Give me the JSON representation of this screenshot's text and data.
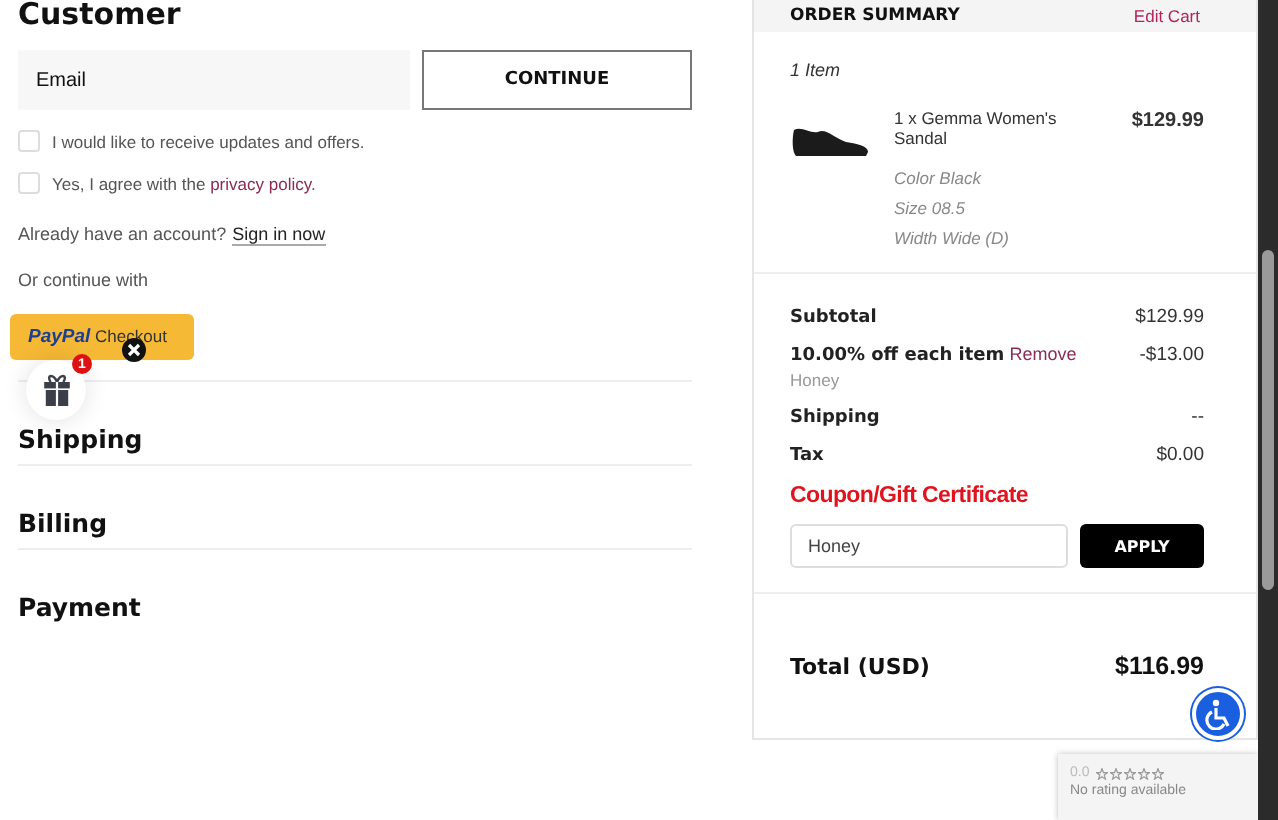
{
  "customer": {
    "heading": "Customer",
    "email": {
      "placeholder": "Email"
    },
    "continue_button": "CONTINUE",
    "checkboxes": [
      {
        "text": "I would like to receive updates and offers.",
        "checked": false
      },
      {
        "text": "Yes, I agree with the ",
        "link": "privacy policy",
        "after": ".",
        "checked": false
      }
    ],
    "account_prompt": "Already have an account?",
    "sign_in_link": "Sign in now",
    "continue_with": "Or continue with",
    "paypal": {
      "brand": "PayPal",
      "label": "Checkout"
    }
  },
  "gift_badge": "1",
  "sections": [
    "Shipping",
    "Billing",
    "Payment"
  ],
  "order_summary": {
    "heading": "ORDER SUMMARY",
    "edit_link": "Edit Cart",
    "item_count": "1 Item",
    "items": [
      {
        "name": "1 x Gemma Women's Sandal",
        "price": "$129.99",
        "details": [
          "Color Black",
          "Size 08.5",
          "Width Wide (D)"
        ]
      }
    ],
    "lines": [
      {
        "label": "Subtotal",
        "value": "$129.99"
      },
      {
        "label": "10.00% off each item",
        "link": "Remove",
        "note": "Honey",
        "value": "-$13.00"
      },
      {
        "label": "Shipping",
        "value": "--"
      },
      {
        "label": "Tax",
        "value": "$0.00"
      }
    ],
    "coupon_heading": "Coupon/Gift Certificate",
    "coupon_value": "Honey",
    "apply_button": "APPLY",
    "total_label": "Total (USD)",
    "total_value": "$116.99"
  },
  "rating_widget": {
    "score": "0.0",
    "stars": 0,
    "text": "No rating available"
  }
}
